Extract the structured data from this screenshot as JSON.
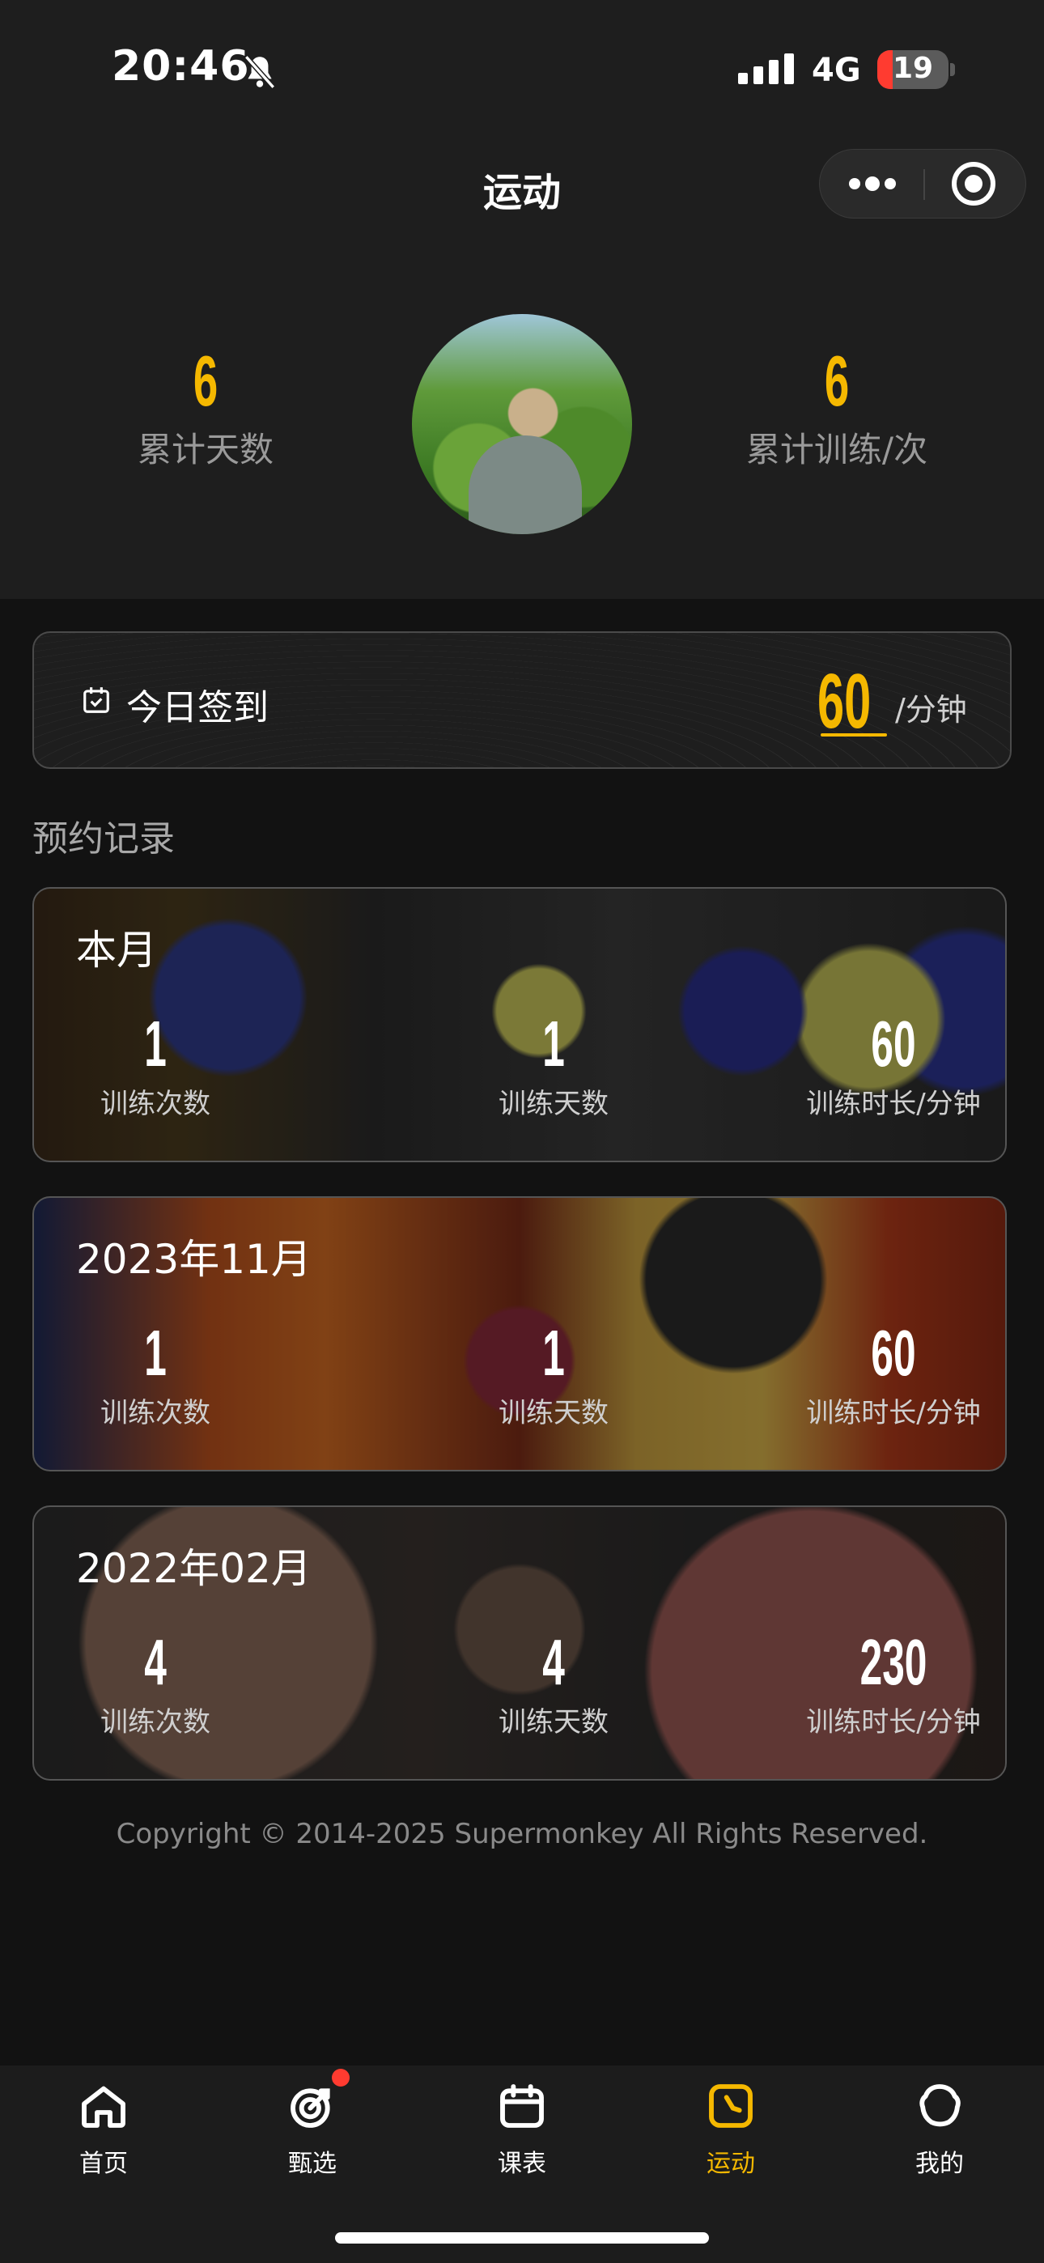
{
  "status_bar": {
    "time": "20:46",
    "network": "4G",
    "battery": "19"
  },
  "nav": {
    "title": "运动"
  },
  "stats": {
    "left": {
      "value": "6",
      "label": "累计天数"
    },
    "right": {
      "value": "6",
      "label": "累计训练/次"
    }
  },
  "checkin": {
    "label": "今日签到",
    "value": "60",
    "unit": "/分钟"
  },
  "section_title": "预约记录",
  "records": [
    {
      "title": "本月",
      "sessions": "1",
      "sessions_label": "训练次数",
      "days": "1",
      "days_label": "训练天数",
      "minutes": "60",
      "minutes_label": "训练时长/分钟"
    },
    {
      "title": "2023年11月",
      "sessions": "1",
      "sessions_label": "训练次数",
      "days": "1",
      "days_label": "训练天数",
      "minutes": "60",
      "minutes_label": "训练时长/分钟"
    },
    {
      "title": "2022年02月",
      "sessions": "4",
      "sessions_label": "训练次数",
      "days": "4",
      "days_label": "训练天数",
      "minutes": "230",
      "minutes_label": "训练时长/分钟"
    }
  ],
  "copyright": "Copyright © 2014-2025 Supermonkey All Rights Reserved.",
  "tabs": [
    {
      "label": "首页",
      "icon": "home-icon"
    },
    {
      "label": "甄选",
      "icon": "target-dart-icon"
    },
    {
      "label": "课表",
      "icon": "calendar-icon"
    },
    {
      "label": "运动",
      "icon": "clock-icon"
    },
    {
      "label": "我的",
      "icon": "profile-icon"
    }
  ],
  "colors": {
    "accent": "#f5b800",
    "background": "#121212",
    "badge": "#ff3b30"
  }
}
